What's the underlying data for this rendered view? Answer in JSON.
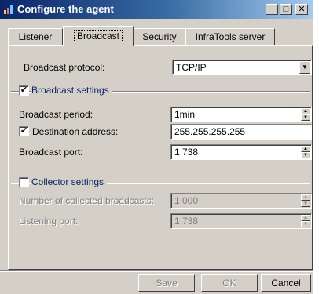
{
  "window": {
    "title": "Configure the agent",
    "controls": {
      "minimize": "_",
      "maximize": "□",
      "close": "✕"
    }
  },
  "tabs": [
    {
      "label": "Listener",
      "active": false
    },
    {
      "label": "Broadcast",
      "active": true
    },
    {
      "label": "Security",
      "active": false
    },
    {
      "label": "InfraTools server",
      "active": false
    }
  ],
  "broadcast": {
    "protocol_label": "Broadcast protocol:",
    "protocol_value": "TCP/IP",
    "settings": {
      "title": "Broadcast settings",
      "checked": true,
      "period_label": "Broadcast period:",
      "period_value": "1min",
      "destination_label": "Destination address:",
      "destination_checked": true,
      "destination_value": "255.255.255.255",
      "port_label": "Broadcast port:",
      "port_value": "1 738"
    },
    "collector": {
      "title": "Collector settings",
      "checked": false,
      "number_label": "Number of collected broadcasts:",
      "number_value": "1 000",
      "listening_label": "Listening port:",
      "listening_value": "1 738"
    }
  },
  "buttons": {
    "save": "Save",
    "ok": "OK",
    "cancel": "Cancel"
  },
  "colors": {
    "titlebar_start": "#0a246a",
    "titlebar_end": "#a6caf0",
    "face": "#d4d0c8",
    "accent_text": "#0a246a"
  }
}
